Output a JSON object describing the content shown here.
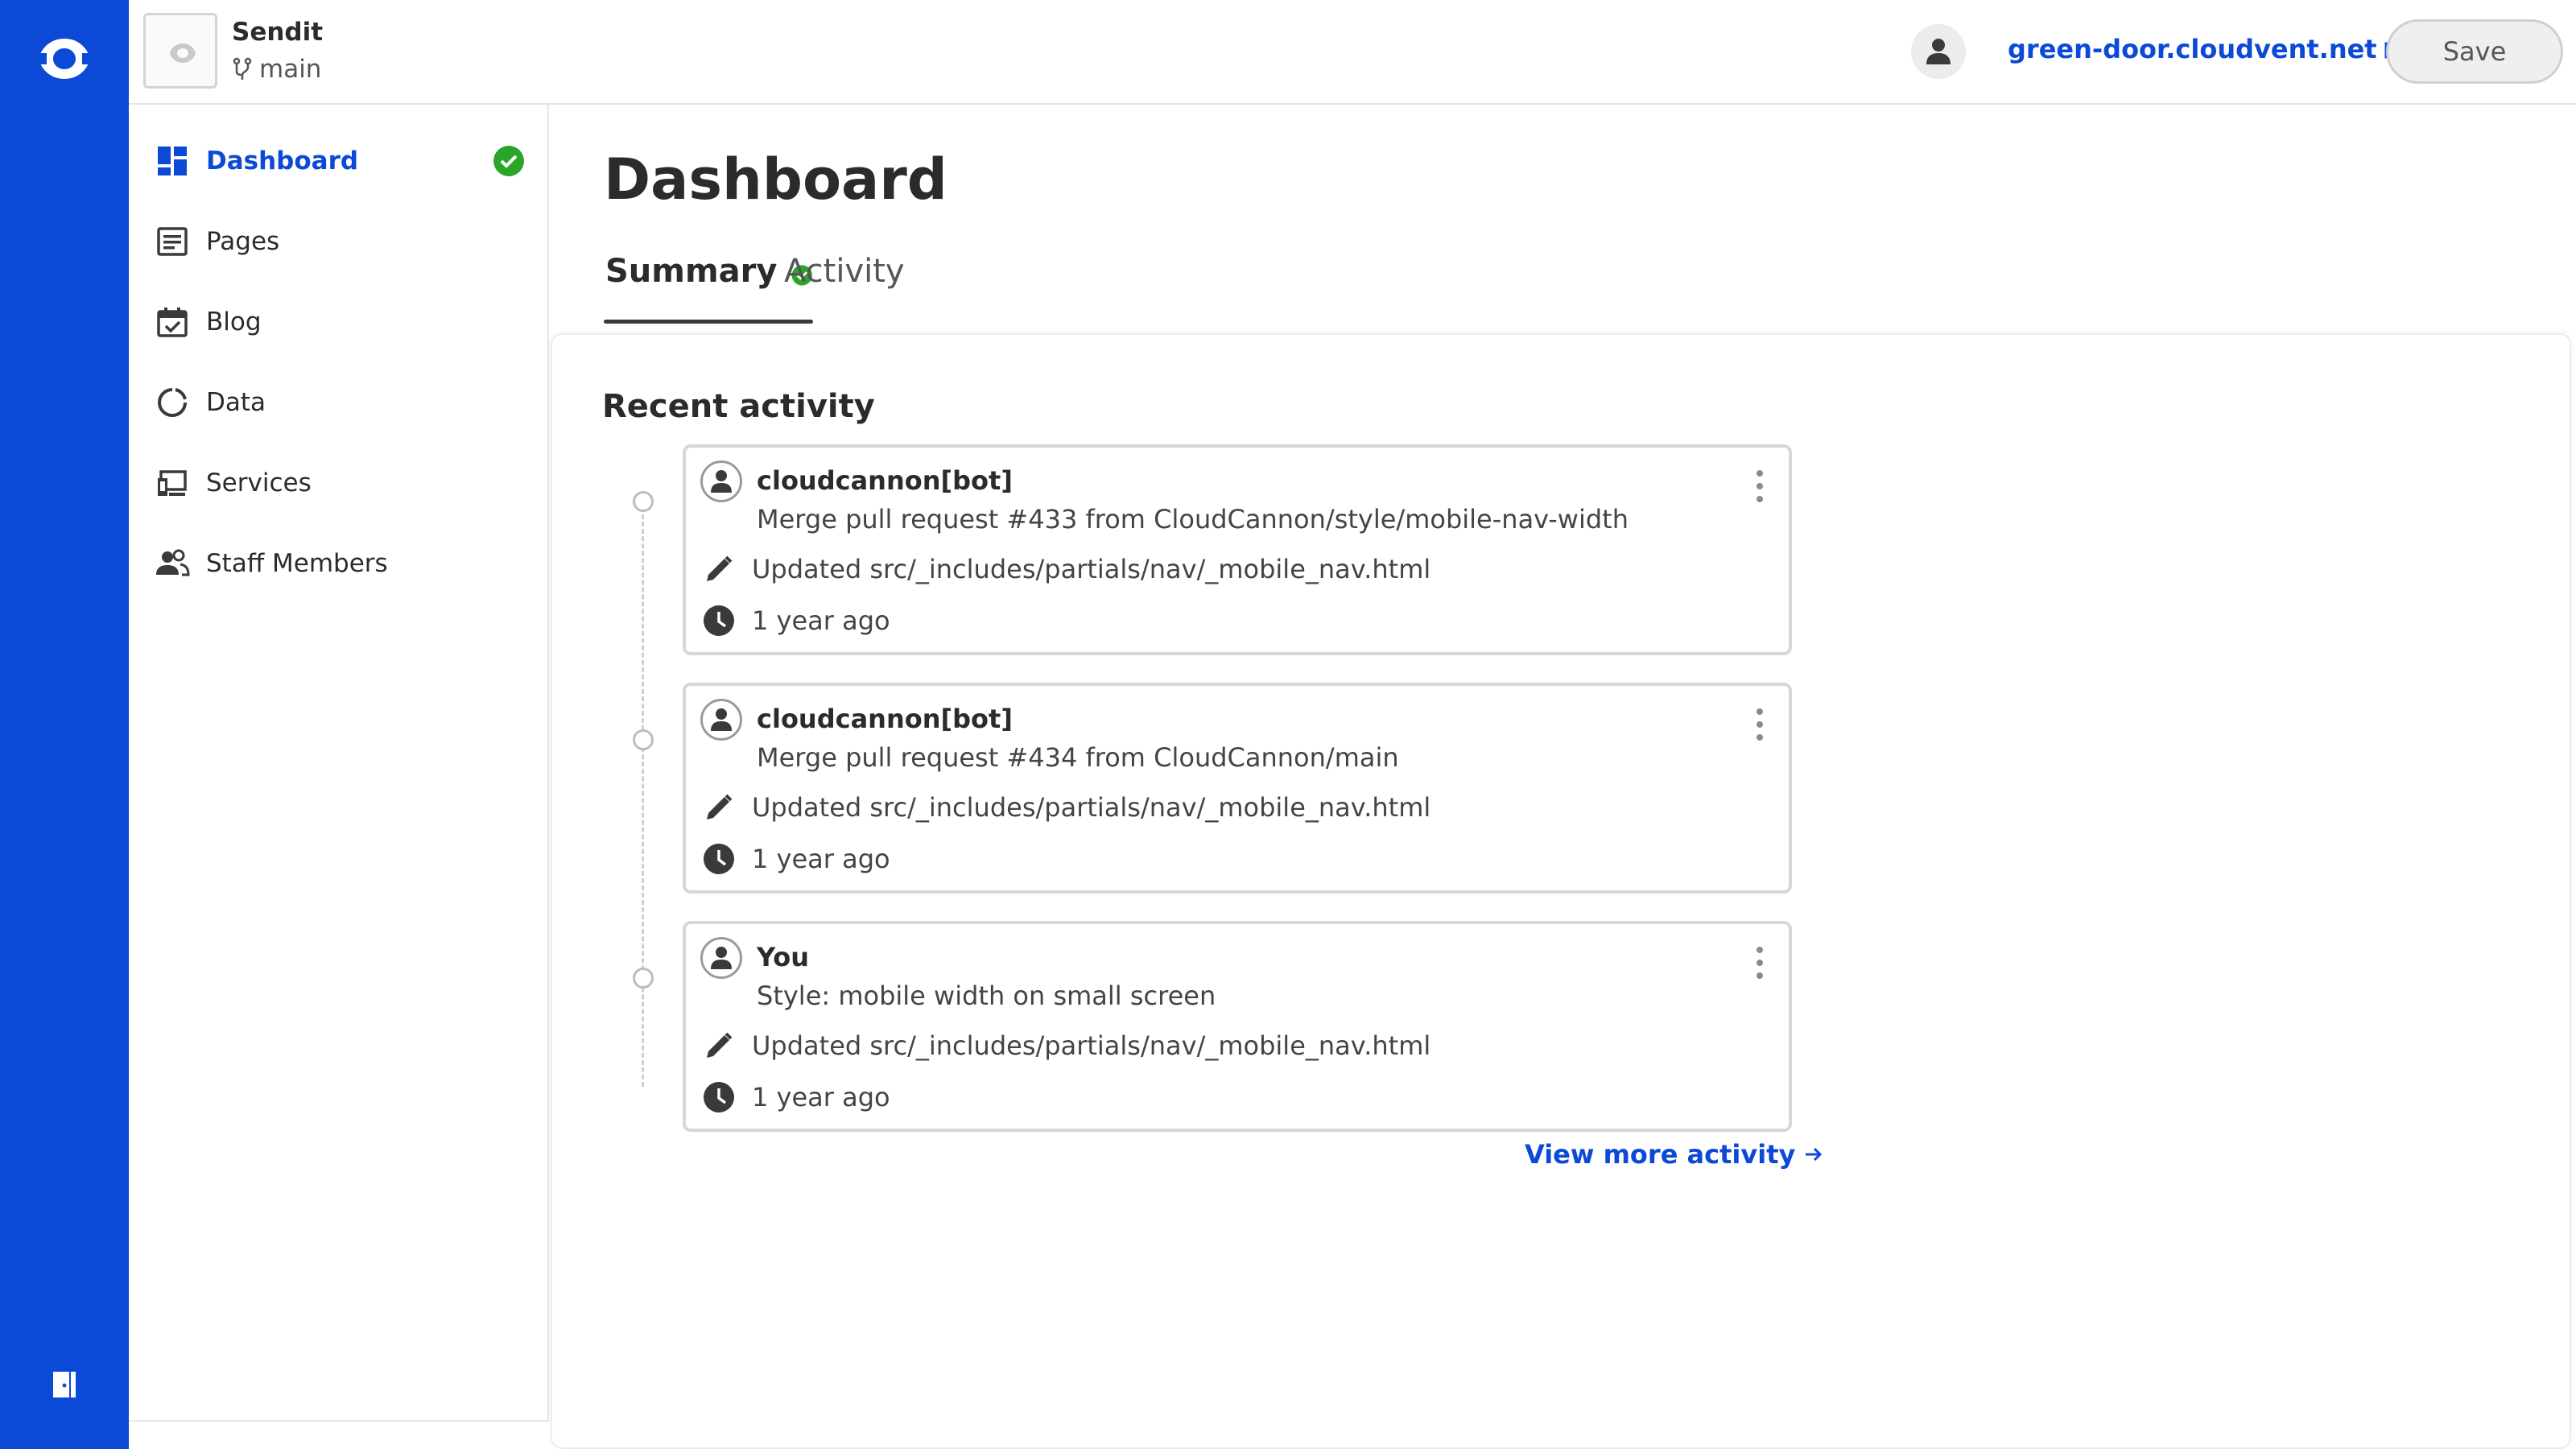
{
  "header": {
    "site_name": "Sendit",
    "branch": "main",
    "site_url": "green-door.cloudvent.net",
    "save_label": "Save"
  },
  "sidebar": {
    "items": [
      {
        "label": "Dashboard",
        "icon": "dashboard-icon",
        "active": true,
        "status": "ok"
      },
      {
        "label": "Pages",
        "icon": "pages-icon"
      },
      {
        "label": "Blog",
        "icon": "blog-calendar-icon"
      },
      {
        "label": "Data",
        "icon": "data-icon"
      },
      {
        "label": "Services",
        "icon": "services-icon"
      },
      {
        "label": "Staff Members",
        "icon": "people-icon"
      }
    ]
  },
  "main": {
    "title": "Dashboard",
    "tabs": [
      {
        "label": "Summary",
        "selected": true,
        "status": "ok"
      },
      {
        "label": "Activity",
        "selected": false
      }
    ],
    "recent_activity": {
      "title": "Recent activity",
      "items": [
        {
          "author": "cloudcannon[bot]",
          "message": "Merge pull request #433 from CloudCannon/style/mobile-nav-width",
          "file": "Updated src/_includes/partials/nav/_mobile_nav.html",
          "time": "1 year ago"
        },
        {
          "author": "cloudcannon[bot]",
          "message": "Merge pull request #434 from CloudCannon/main",
          "file": "Updated src/_includes/partials/nav/_mobile_nav.html",
          "time": "1 year ago"
        },
        {
          "author": "You",
          "message": "Style: mobile width on small screen",
          "file": "Updated src/_includes/partials/nav/_mobile_nav.html",
          "time": "1 year ago"
        }
      ],
      "view_more_label": "View more activity"
    }
  },
  "colors": {
    "brand_blue": "#0c49d6",
    "success_green": "#2aa52a",
    "text_dark": "#2b2b2b"
  }
}
